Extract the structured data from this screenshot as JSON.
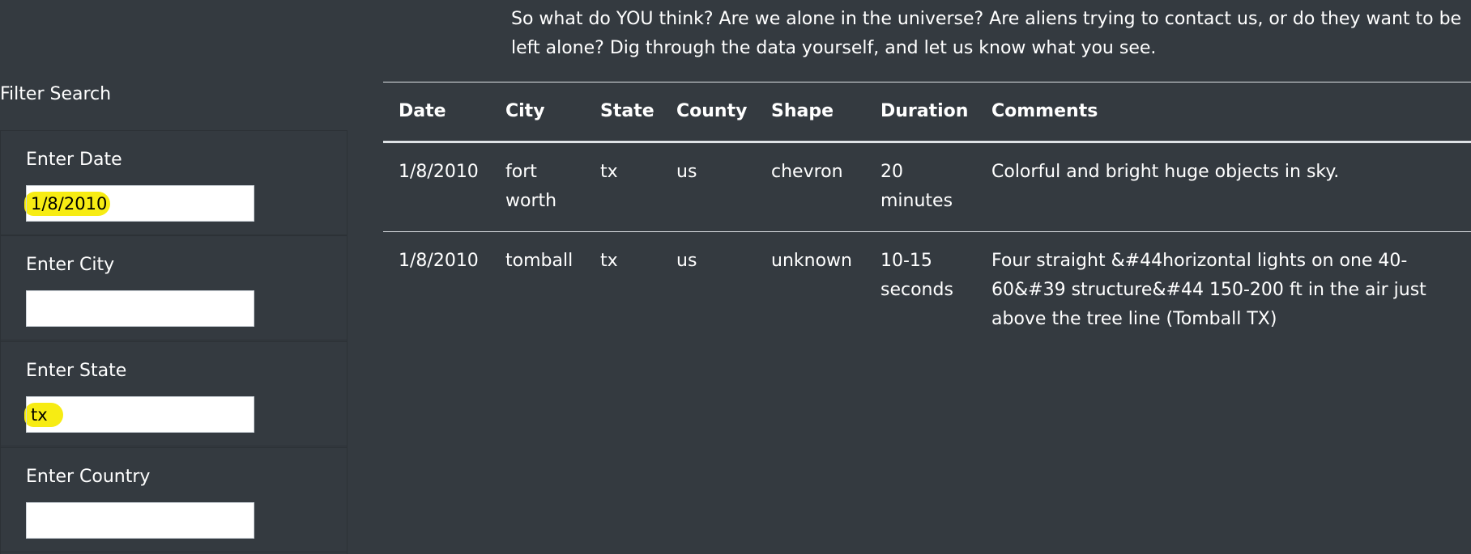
{
  "intro": {
    "text": "So what do YOU think? Are we alone in the universe? Are aliens trying to contact us, or do they want to be left alone? Dig through the data yourself, and let us know what you see."
  },
  "filters": {
    "title": "Filter Search",
    "items": [
      {
        "label": "Enter Date",
        "value": "1/8/2010",
        "highlighted": true
      },
      {
        "label": "Enter City",
        "value": "",
        "highlighted": false
      },
      {
        "label": "Enter State",
        "value": "tx",
        "highlighted": true
      },
      {
        "label": "Enter Country",
        "value": "",
        "highlighted": false
      }
    ],
    "highlight_color": "#f7ec13"
  },
  "table": {
    "headers": [
      "Date",
      "City",
      "State",
      "County",
      "Shape",
      "Duration",
      "Comments"
    ],
    "rows": [
      [
        "1/8/2010",
        "fort worth",
        "tx",
        "us",
        "chevron",
        "20 minutes",
        "Colorful and bright huge objects in sky."
      ],
      [
        "1/8/2010",
        "tomball",
        "tx",
        "us",
        "unknown",
        "10-15 seconds",
        "Four straight &#44horizontal lights on one 40-60&#39 structure&#44 150-200 ft in the air just above the tree line (Tomball TX)"
      ]
    ]
  },
  "colors": {
    "background": "#343a40",
    "text": "#ffffff",
    "divider": "#dee2e6"
  }
}
